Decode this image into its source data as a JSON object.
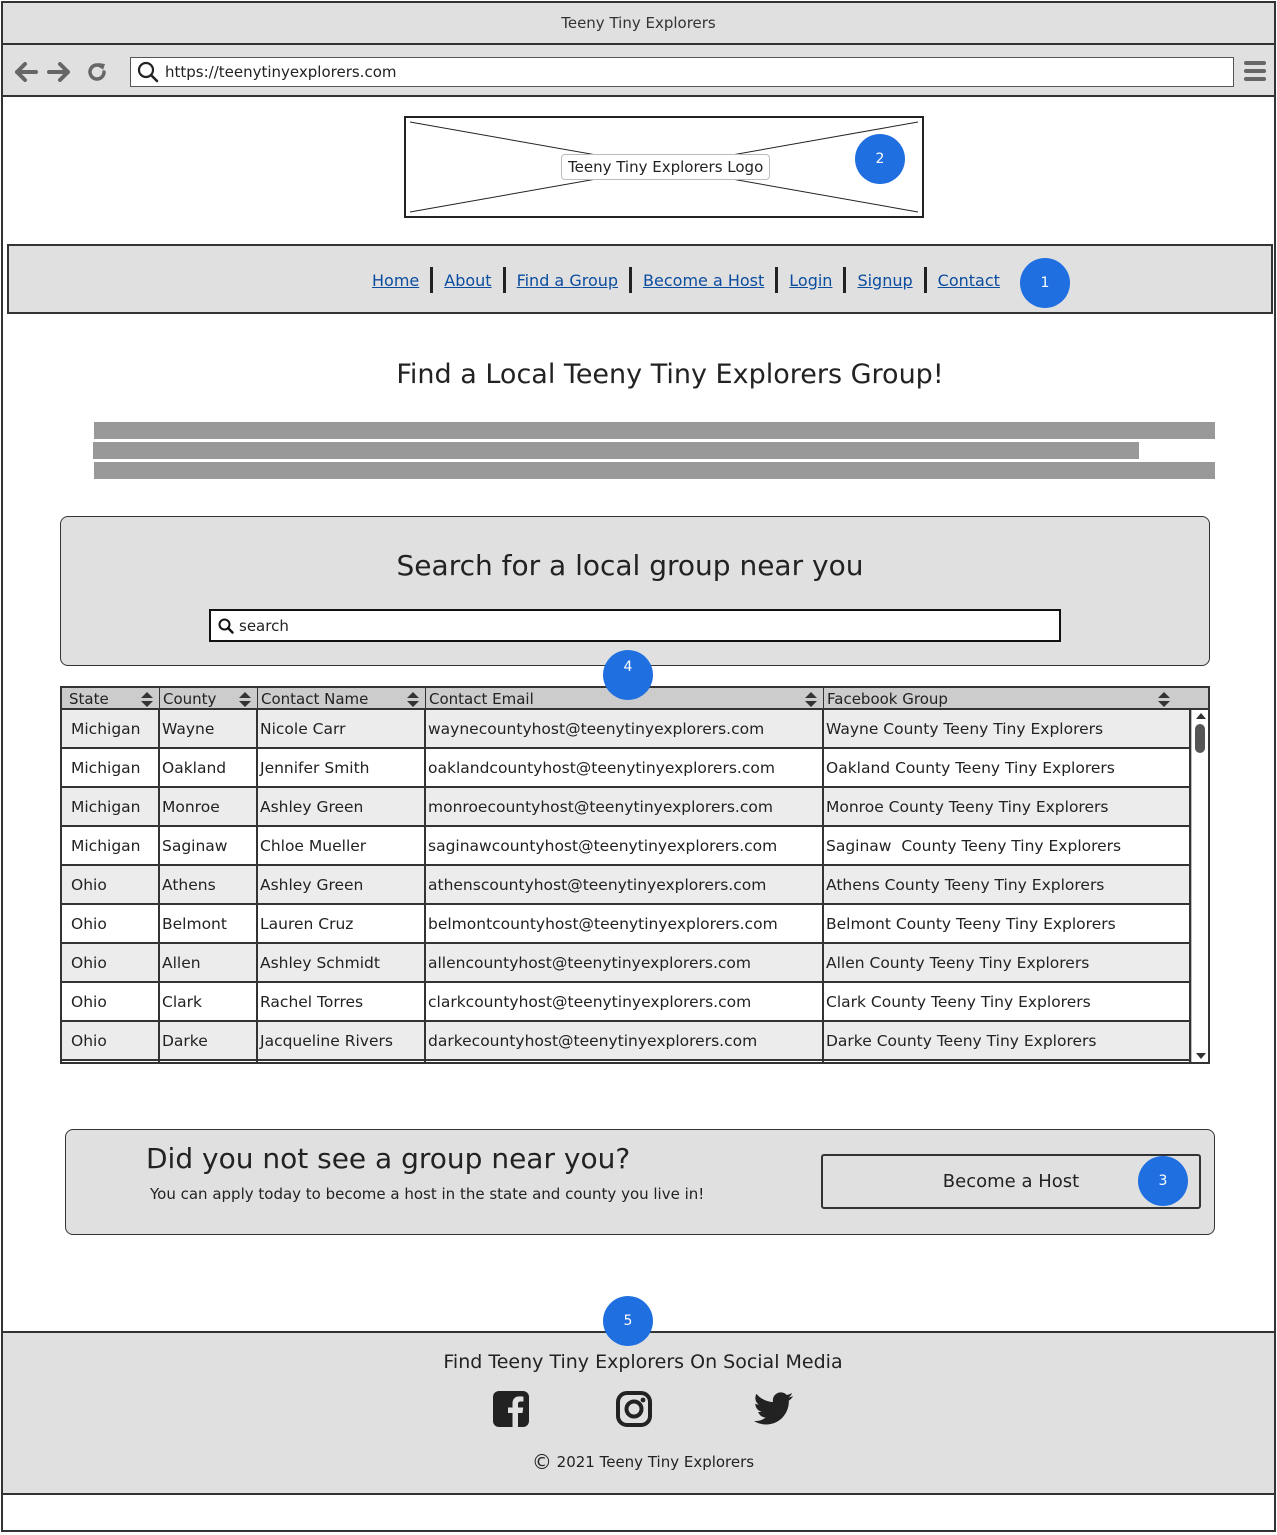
{
  "window": {
    "title": "Teeny Tiny Explorers"
  },
  "browser": {
    "url": "https://teenytinyexplorers.com"
  },
  "logo": {
    "label": "Teeny Tiny Explorers Logo"
  },
  "nav": {
    "items": [
      {
        "label": "Home"
      },
      {
        "label": "About"
      },
      {
        "label": "Find a Group"
      },
      {
        "label": "Become a Host"
      },
      {
        "label": "Login"
      },
      {
        "label": "Signup"
      },
      {
        "label": "Contact"
      }
    ]
  },
  "page": {
    "heading": "Find a Local Teeny Tiny Explorers Group!"
  },
  "search": {
    "title": "Search for a local group near you",
    "placeholder": "search"
  },
  "table": {
    "columns": [
      "State",
      "County",
      "Contact Name",
      "Contact Email",
      "Facebook Group"
    ],
    "rows": [
      [
        "Michigan",
        "Wayne",
        "Nicole Carr",
        "waynecountyhost@teenytinyexplorers.com",
        "Wayne County Teeny Tiny Explorers"
      ],
      [
        "Michigan",
        "Oakland",
        "Jennifer Smith",
        "oaklandcountyhost@teenytinyexplorers.com",
        "Oakland County Teeny Tiny Explorers"
      ],
      [
        "Michigan",
        "Monroe",
        "Ashley Green",
        "monroecountyhost@teenytinyexplorers.com",
        "Monroe County Teeny Tiny Explorers"
      ],
      [
        "Michigan",
        "Saginaw",
        "Chloe Mueller",
        "saginawcountyhost@teenytinyexplorers.com",
        "Saginaw  County Teeny Tiny Explorers"
      ],
      [
        "Ohio",
        "Athens",
        "Ashley Green",
        "athenscountyhost@teenytinyexplorers.com",
        "Athens County Teeny Tiny Explorers"
      ],
      [
        "Ohio",
        "Belmont",
        "Lauren Cruz",
        "belmontcountyhost@teenytinyexplorers.com",
        "Belmont County Teeny Tiny Explorers"
      ],
      [
        "Ohio",
        "Allen",
        "Ashley Schmidt",
        "allencountyhost@teenytinyexplorers.com",
        "Allen County Teeny Tiny Explorers"
      ],
      [
        "Ohio",
        "Clark",
        "Rachel Torres",
        "clarkcountyhost@teenytinyexplorers.com",
        "Clark County Teeny Tiny Explorers"
      ],
      [
        "Ohio",
        "Darke",
        "Jacqueline Rivers",
        "darkecountyhost@teenytinyexplorers.com",
        "Darke County Teeny Tiny Explorers"
      ]
    ]
  },
  "cta": {
    "title": "Did you not see a group near you?",
    "subtitle": "You can apply today to become a host in the state and county you live in!",
    "button_label": "Become a Host"
  },
  "footer": {
    "title": "Find Teeny Tiny Explorers On Social Media",
    "social_icons": [
      "facebook-icon",
      "instagram-icon",
      "twitter-icon"
    ],
    "copyright_symbol": "©",
    "copyright": "2021 Teeny Tiny Explorers"
  },
  "annotations": {
    "badges": [
      "1",
      "2",
      "3",
      "4",
      "5"
    ]
  },
  "colors": {
    "badge": "#1f6fe0",
    "link": "#0a4c9f",
    "panel": "#e0e0e0",
    "placeholder_bar": "#999999"
  }
}
